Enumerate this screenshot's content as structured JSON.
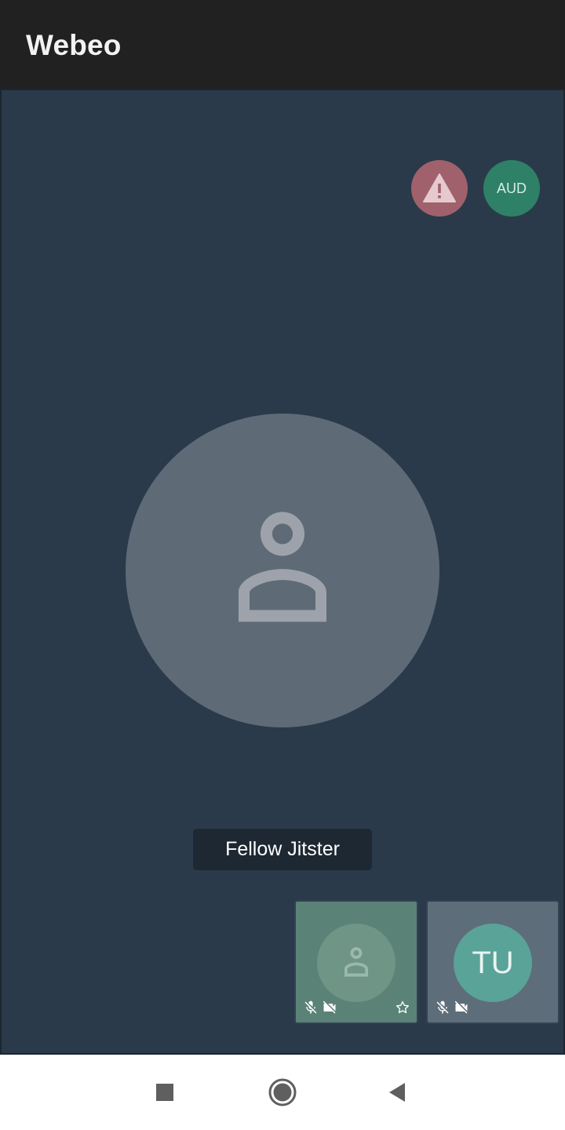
{
  "app_bar": {
    "title": "Webeo"
  },
  "stage": {
    "indicators": {
      "warning_icon": "warning-icon",
      "audio_label": "AUD"
    },
    "main_participant": {
      "avatar_icon": "person-icon",
      "display_name": "Fellow Jitster"
    },
    "filmstrip": [
      {
        "avatar_icon": "person-icon",
        "status_icons": [
          "mic-off-icon",
          "video-off-icon"
        ],
        "pinned_icon": "star-icon"
      },
      {
        "initials": "TU",
        "status_icons": [
          "mic-off-icon",
          "video-off-icon"
        ]
      }
    ]
  },
  "nav_bar": {
    "buttons": [
      "recents-icon",
      "home-icon",
      "back-icon"
    ]
  },
  "colors": {
    "app_bar_bg": "#212121",
    "stage_bg": "#2b3a4a",
    "warning": "#a0616c",
    "audio_indicator": "#2e8166",
    "remote_tile": "#5b8276",
    "local_avatar": "#5aa398"
  }
}
